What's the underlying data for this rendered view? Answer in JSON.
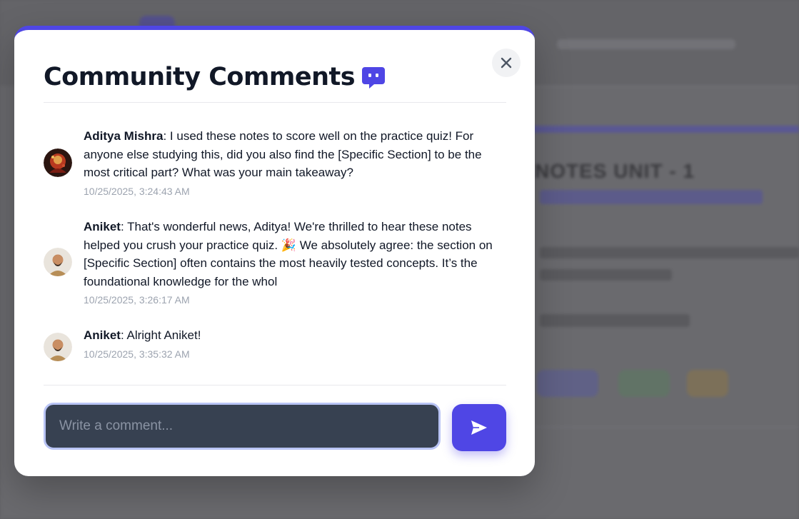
{
  "background": {
    "heading": "NOTES UNIT - 1"
  },
  "modal": {
    "title": "Community Comments",
    "title_icon": "chat-bubble-icon",
    "close_icon": "close-icon",
    "accent_color": "#4f46e5"
  },
  "comments": [
    {
      "author": "Aditya Mishra",
      "text": ": I used these notes to score well on the practice quiz! For anyone else studying this, did you also find the [Specific Section] to be the most critical part? What was your main takeaway?",
      "timestamp": "10/25/2025, 3:24:43 AM",
      "avatar": "avatar-red"
    },
    {
      "author": "Aniket",
      "text": ": That's wonderful news, Aditya! We're thrilled to hear these notes helped you crush your practice quiz. 🎉 We absolutely agree: the section on [Specific Section] often contains the most heavily tested concepts. It’s the foundational knowledge for the whol",
      "timestamp": "10/25/2025, 3:26:17 AM",
      "avatar": "avatar-person"
    },
    {
      "author": "Aniket",
      "text": ": Alright Aniket!",
      "timestamp": "10/25/2025, 3:35:32 AM",
      "avatar": "avatar-person"
    }
  ],
  "composer": {
    "placeholder": "Write a comment...",
    "value": "",
    "send_icon": "send-icon"
  }
}
